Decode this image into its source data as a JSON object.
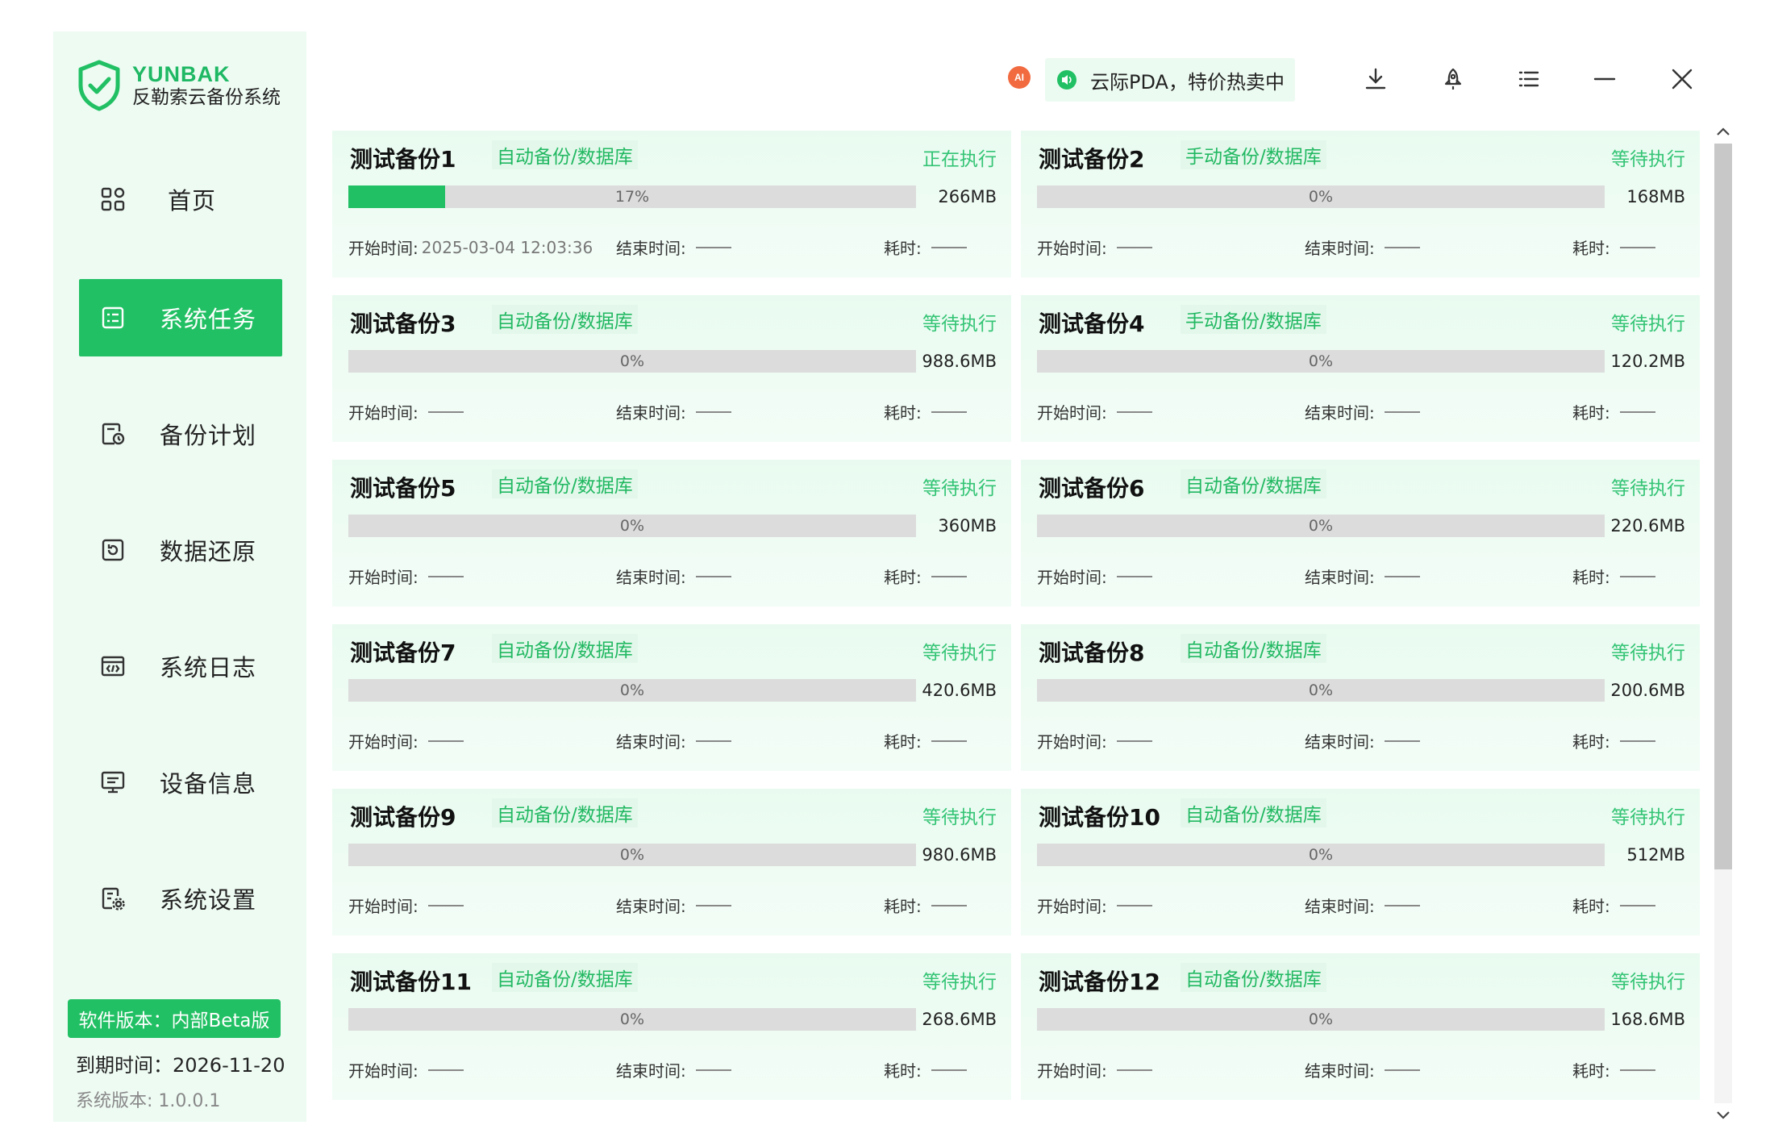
{
  "brand": {
    "name": "YUNBAK",
    "subtitle": "反勒索云备份系统"
  },
  "nav": [
    {
      "label": "首页",
      "icon": "grid-icon",
      "active": false
    },
    {
      "label": "系统任务",
      "icon": "task-list-icon",
      "active": true
    },
    {
      "label": "备份计划",
      "icon": "schedule-icon",
      "active": false
    },
    {
      "label": "数据还原",
      "icon": "restore-icon",
      "active": false
    },
    {
      "label": "系统日志",
      "icon": "log-icon",
      "active": false
    },
    {
      "label": "设备信息",
      "icon": "monitor-icon",
      "active": false
    },
    {
      "label": "系统设置",
      "icon": "settings-icon",
      "active": false
    }
  ],
  "footer": {
    "version_badge": "软件版本：内部Beta版",
    "expire": "到期时间：2026-11-20",
    "system_version": "系统版本: 1.0.0.1"
  },
  "titlebar": {
    "ai_badge": "AI",
    "notice": "云际PDA，特价热卖中",
    "buttons": [
      "download-icon",
      "rocket-icon",
      "menu-icon",
      "minimize-icon",
      "close-icon"
    ]
  },
  "labels": {
    "start": "开始时间:",
    "end": "结束时间:",
    "cost": "耗时:"
  },
  "colors": {
    "accent": "#22c064",
    "sidebar_bg": "#eefbf3",
    "card_bg": "#eefbf3",
    "status_text": "#34c475"
  },
  "tasks": [
    {
      "title": "测试备份1",
      "tag": "自动备份/数据库",
      "status": "正在执行",
      "progress": 17,
      "progress_text": "17%",
      "size": "266MB",
      "start": "2025-03-04 12:03:36"
    },
    {
      "title": "测试备份2",
      "tag": "手动备份/数据库",
      "status": "等待执行",
      "progress": 0,
      "progress_text": "0%",
      "size": "168MB",
      "start": ""
    },
    {
      "title": "测试备份3",
      "tag": "自动备份/数据库",
      "status": "等待执行",
      "progress": 0,
      "progress_text": "0%",
      "size": "988.6MB",
      "start": ""
    },
    {
      "title": "测试备份4",
      "tag": "手动备份/数据库",
      "status": "等待执行",
      "progress": 0,
      "progress_text": "0%",
      "size": "120.2MB",
      "start": ""
    },
    {
      "title": "测试备份5",
      "tag": "自动备份/数据库",
      "status": "等待执行",
      "progress": 0,
      "progress_text": "0%",
      "size": "360MB",
      "start": ""
    },
    {
      "title": "测试备份6",
      "tag": "自动备份/数据库",
      "status": "等待执行",
      "progress": 0,
      "progress_text": "0%",
      "size": "220.6MB",
      "start": ""
    },
    {
      "title": "测试备份7",
      "tag": "自动备份/数据库",
      "status": "等待执行",
      "progress": 0,
      "progress_text": "0%",
      "size": "420.6MB",
      "start": ""
    },
    {
      "title": "测试备份8",
      "tag": "自动备份/数据库",
      "status": "等待执行",
      "progress": 0,
      "progress_text": "0%",
      "size": "200.6MB",
      "start": ""
    },
    {
      "title": "测试备份9",
      "tag": "自动备份/数据库",
      "status": "等待执行",
      "progress": 0,
      "progress_text": "0%",
      "size": "980.6MB",
      "start": ""
    },
    {
      "title": "测试备份10",
      "tag": "自动备份/数据库",
      "status": "等待执行",
      "progress": 0,
      "progress_text": "0%",
      "size": "512MB",
      "start": ""
    },
    {
      "title": "测试备份11",
      "tag": "自动备份/数据库",
      "status": "等待执行",
      "progress": 0,
      "progress_text": "0%",
      "size": "268.6MB",
      "start": ""
    },
    {
      "title": "测试备份12",
      "tag": "自动备份/数据库",
      "status": "等待执行",
      "progress": 0,
      "progress_text": "0%",
      "size": "168.6MB",
      "start": ""
    }
  ]
}
